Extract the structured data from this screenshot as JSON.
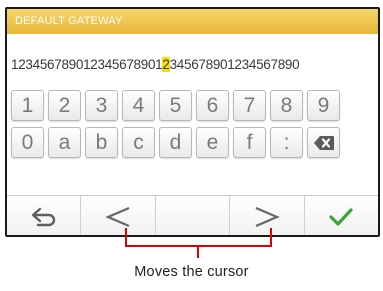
{
  "screen": {
    "title": "DEFAULT GATEWAY",
    "input": {
      "before_cursor": "123456789012345678901",
      "cursor_char": "2",
      "after_cursor": "345678901234567890"
    }
  },
  "keyboard": {
    "row1": [
      "1",
      "2",
      "3",
      "4",
      "5",
      "6",
      "7",
      "8",
      "9"
    ],
    "row2": [
      "0",
      "a",
      "b",
      "c",
      "d",
      "e",
      "f",
      ":"
    ],
    "row2_delete_icon": "backspace-icon"
  },
  "bottom_bar": {
    "buttons": [
      "back-arrow-icon",
      "cursor-left-icon",
      "blank",
      "cursor-right-icon",
      "checkmark-icon"
    ]
  },
  "annotation": {
    "caption": "Moves the cursor",
    "color": "#e00000"
  },
  "colors": {
    "title_bar": "#e9b53a",
    "cursor_highlight": "#f6e100",
    "confirm_green": "#3aa63a",
    "icon_gray": "#6a6a6a"
  }
}
